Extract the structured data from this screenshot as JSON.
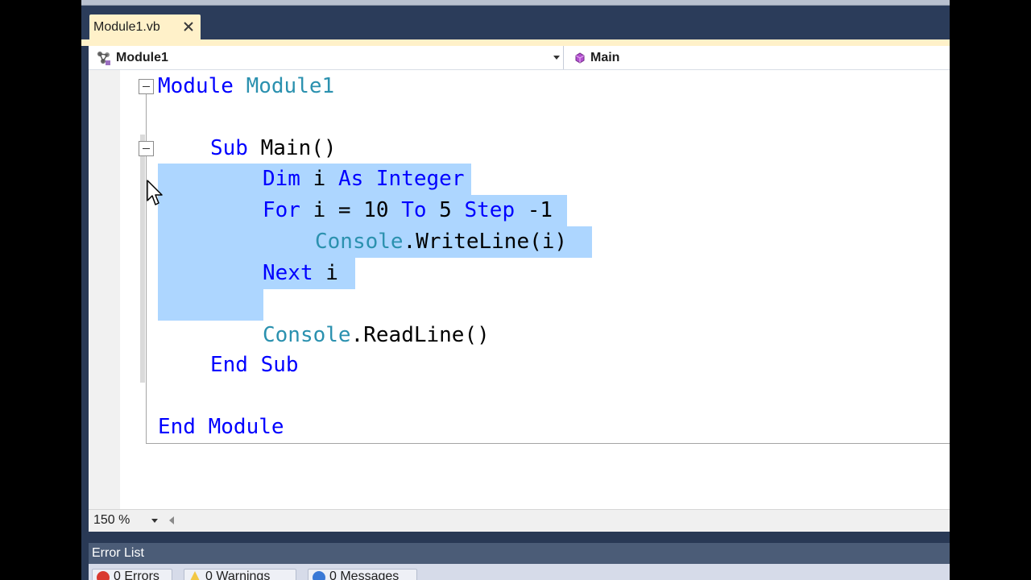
{
  "tab": {
    "label": "Module1.vb"
  },
  "nav": {
    "type_label": "Module1",
    "member_label": "Main"
  },
  "code": {
    "l1": {
      "kw": "Module",
      "name": "Module1"
    },
    "l2": {
      "kw": "Sub",
      "rest": "Main()"
    },
    "l3": {
      "kw1": "Dim",
      "var": "i",
      "kw2": "As",
      "kw3": "Integer"
    },
    "l4": {
      "kw1": "For",
      "mid": "i = 10",
      "kw2": "To",
      "mid2": "5",
      "kw3": "Step",
      "rest": "-1"
    },
    "l5": {
      "ty": "Console",
      "rest": ".WriteLine(i)"
    },
    "l6": {
      "kw": "Next",
      "rest": "i"
    },
    "l7": {
      "ty": "Console",
      "rest": ".ReadLine()"
    },
    "l8": {
      "kw1": "End",
      "kw2": "Sub"
    },
    "l9": {
      "kw1": "End",
      "kw2": "Module"
    }
  },
  "zoom": {
    "label": "150 %"
  },
  "error_list": {
    "title": "Error List",
    "errors": "0 Errors",
    "warnings": "0 Warnings",
    "messages": "0 Messages"
  },
  "colors": {
    "keyword": "#0000ff",
    "type": "#2b91af",
    "selection": "#add6ff",
    "tab_active": "#fff1c9",
    "chrome": "#293955"
  }
}
